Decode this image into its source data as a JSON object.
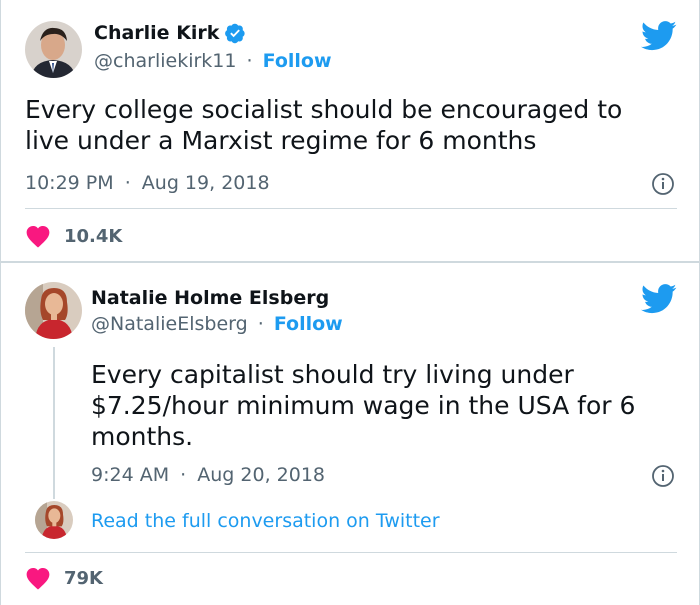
{
  "tweet1": {
    "name": "Charlie Kirk",
    "handle": "@charliekirk11",
    "separator": "·",
    "follow": "Follow",
    "text": "Every college socialist should be encouraged to live under a Marxist regime for 6 months",
    "time": "10:29 PM",
    "date": "Aug 19, 2018",
    "likes": "10.4K",
    "verified_color": "#1d9bf0"
  },
  "tweet2": {
    "name": "Natalie Holme Elsberg",
    "handle": "@NatalieElsberg",
    "separator": "·",
    "follow": "Follow",
    "text": "Every capitalist should try living under $7.25/hour minimum wage in the USA for 6 months.",
    "time": "9:24 AM",
    "date": "Aug 20, 2018",
    "read_more": "Read the full conversation on Twitter",
    "likes": "79K"
  },
  "colors": {
    "accent": "#1d9bf0",
    "heart": "#f91880",
    "text": "#0f1419",
    "muted": "#536471"
  }
}
